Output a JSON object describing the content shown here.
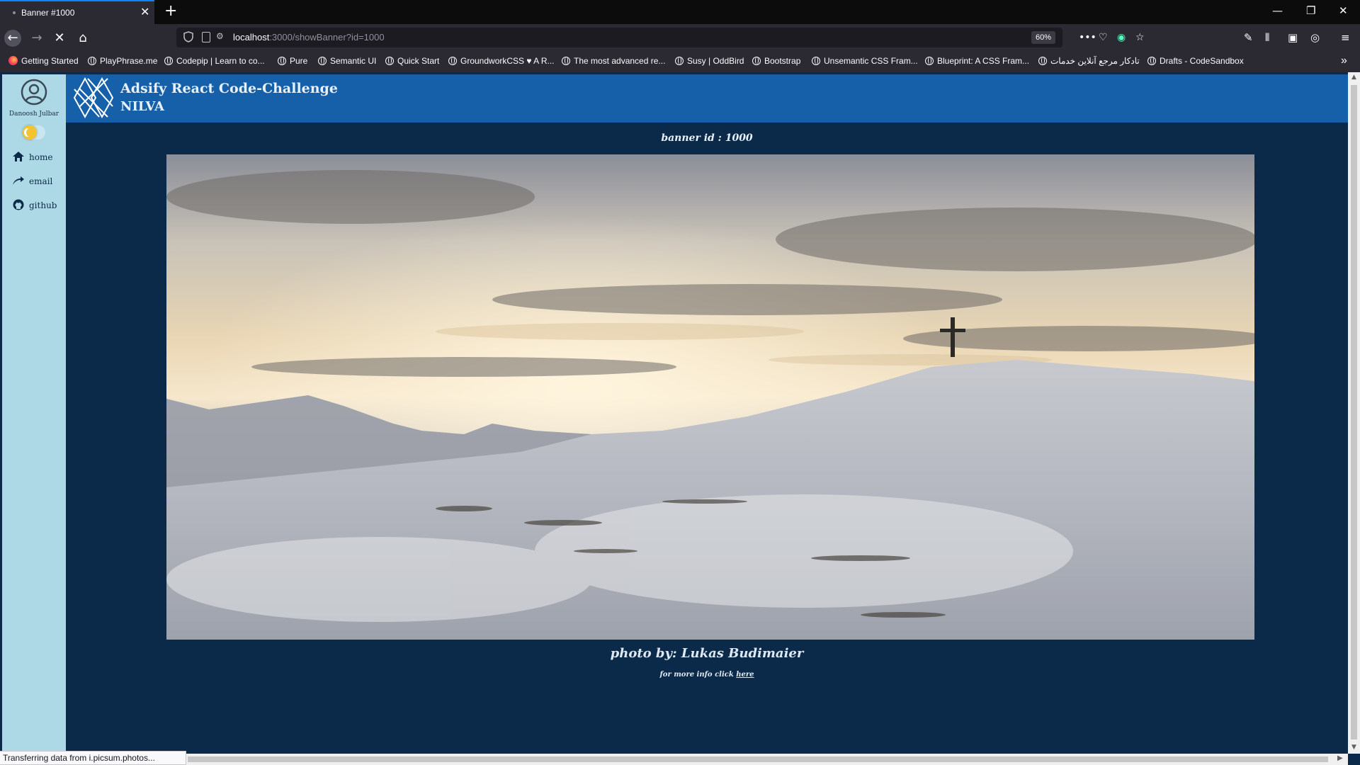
{
  "browser": {
    "tab_title": "Banner #1000",
    "url_host": "localhost",
    "url_path": ":3000/showBanner?id=1000",
    "zoom": "60%",
    "bookmarks": [
      "Getting Started",
      "PlayPhrase.me",
      "Codepip | Learn to co...",
      "Pure",
      "Semantic UI",
      "Quick Start",
      "GroundworkCSS ♥ A R...",
      "The most advanced re...",
      "Susy | OddBird",
      "Bootstrap",
      "Unsemantic CSS Fram...",
      "Blueprint: A CSS Fram...",
      "تادکار مرجع آنلاین خدمات",
      "Drafts - CodeSandbox"
    ],
    "status_text": "Transferring data from i.picsum.photos..."
  },
  "sidebar": {
    "username": "Danoosh Julbar",
    "links": [
      {
        "label": "home",
        "icon": "home-icon"
      },
      {
        "label": "email",
        "icon": "send-icon"
      },
      {
        "label": "github",
        "icon": "github-icon"
      }
    ],
    "theme_toggle_icon": "moon-icon"
  },
  "header": {
    "title": "Adsify React Code-Challenge",
    "subtitle": "NILVA"
  },
  "main": {
    "banner_label": "banner id : 1000",
    "photo_credit": "photo by: Lukas Budimaier",
    "more_info_text": "for more info click ",
    "more_info_link": "here"
  },
  "colors": {
    "page_bg": "#0b2a49",
    "header_bg": "#1560a8",
    "sidebar_bg": "#add8e6"
  }
}
